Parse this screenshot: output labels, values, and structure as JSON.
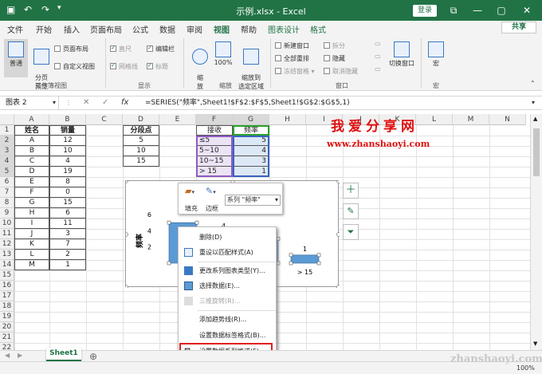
{
  "titlebar": {
    "title": "示例.xlsx - Excel",
    "login": "登录",
    "minimize": "—",
    "restore": "▢",
    "close": "✕",
    "ribbon_display": "⧉"
  },
  "tabs": [
    "文件",
    "开始",
    "插入",
    "页面布局",
    "公式",
    "数据",
    "审阅",
    "视图",
    "帮助",
    "图表设计",
    "格式"
  ],
  "active_tab": "视图",
  "share": "共享",
  "ribbon": {
    "workbook_views": {
      "normal": "普通",
      "page_break": "分页\n预览",
      "page_layout": "页面布局",
      "custom_views": "自定义视图",
      "group": "工作簿视图"
    },
    "show": {
      "ruler": "直尺",
      "formula_bar": "编辑栏",
      "gridlines": "网格线",
      "headings": "标题",
      "group": "显示"
    },
    "zoom": {
      "zoom": "缩\n放",
      "zoom100": "100%",
      "zoom_selection": "缩放到\n选定区域",
      "group": "缩放"
    },
    "window": {
      "new_window": "新建窗口",
      "arrange_all": "全部重排",
      "freeze": "冻结窗格",
      "split": "拆分",
      "hide": "隐藏",
      "unhide": "取消隐藏",
      "switch": "切换窗口",
      "group": "窗口"
    },
    "macros": {
      "macro": "宏",
      "group": "宏"
    }
  },
  "formula_bar": {
    "name_box": "图表 2",
    "cancel": "✕",
    "enter": "✓",
    "fx": "fx",
    "formula": "=SERIES(\"频率\",Sheet1!$F$2:$F$5,Sheet1!$G$2:$G$5,1)"
  },
  "columns": [
    "A",
    "B",
    "C",
    "D",
    "E",
    "F",
    "G",
    "H",
    "I",
    "J",
    "K",
    "L",
    "M",
    "N"
  ],
  "rows": [
    "1",
    "2",
    "3",
    "4",
    "5",
    "6",
    "7",
    "8",
    "9",
    "10",
    "11",
    "12",
    "13",
    "14",
    "15",
    "16",
    "17",
    "18",
    "19",
    "20",
    "21",
    "22"
  ],
  "table1": {
    "headers": [
      "姓名",
      "销量"
    ],
    "rows": [
      [
        "A",
        "12"
      ],
      [
        "B",
        "10"
      ],
      [
        "C",
        "4"
      ],
      [
        "D",
        "19"
      ],
      [
        "E",
        "8"
      ],
      [
        "F",
        "0"
      ],
      [
        "G",
        "15"
      ],
      [
        "H",
        "6"
      ],
      [
        "I",
        "11"
      ],
      [
        "J",
        "3"
      ],
      [
        "K",
        "7"
      ],
      [
        "L",
        "2"
      ],
      [
        "M",
        "1"
      ]
    ]
  },
  "bins": {
    "header": "分段点",
    "values": [
      "5",
      "10",
      "15"
    ]
  },
  "freq": {
    "headers": [
      "接收",
      "频率"
    ],
    "rows": [
      [
        "≤5",
        "5"
      ],
      [
        "5~10",
        "4"
      ],
      [
        "10~15",
        "3"
      ],
      [
        "> 15",
        "1"
      ]
    ]
  },
  "chart_data": {
    "type": "bar",
    "categories": [
      "≤5",
      "5~10",
      "10~15",
      "> 15"
    ],
    "series": [
      {
        "name": "频率",
        "values": [
          5,
          4,
          3,
          1
        ]
      }
    ],
    "ylabel": "频率",
    "ylim": [
      0,
      6
    ],
    "yticks": [
      "6",
      "4",
      "2"
    ],
    "visible_data_labels": [
      "4",
      "1"
    ],
    "visible_cat_labels": [
      "≤5",
      "> 15"
    ]
  },
  "minibar": {
    "fill": "填充",
    "outline": "边框",
    "series_dropdown": "系列 \"频率\""
  },
  "context_menu": [
    {
      "label": "删除(D)",
      "enabled": true
    },
    {
      "label": "重设以匹配样式(A)",
      "enabled": true
    },
    {
      "label": "更改系列图表类型(Y)...",
      "enabled": true
    },
    {
      "label": "选择数据(E)...",
      "enabled": true
    },
    {
      "label": "三维旋转(R)...",
      "enabled": false
    },
    {
      "label": "添加趋势线(R)...",
      "enabled": true
    },
    {
      "label": "设置数据标签格式(B)...",
      "enabled": true
    },
    {
      "label": "设置数据系列格式(F)...",
      "enabled": true
    }
  ],
  "sheet_tab": "Sheet1",
  "zoom_level": "100%",
  "watermark": {
    "line1": "我爱分享网",
    "line2": "www.zhanshaoyi.com",
    "line3": "zhanshaoyi.com"
  },
  "colors": {
    "excel_green": "#217346",
    "bar_blue": "#5b9bd5",
    "highlight_red": "#e02020"
  }
}
